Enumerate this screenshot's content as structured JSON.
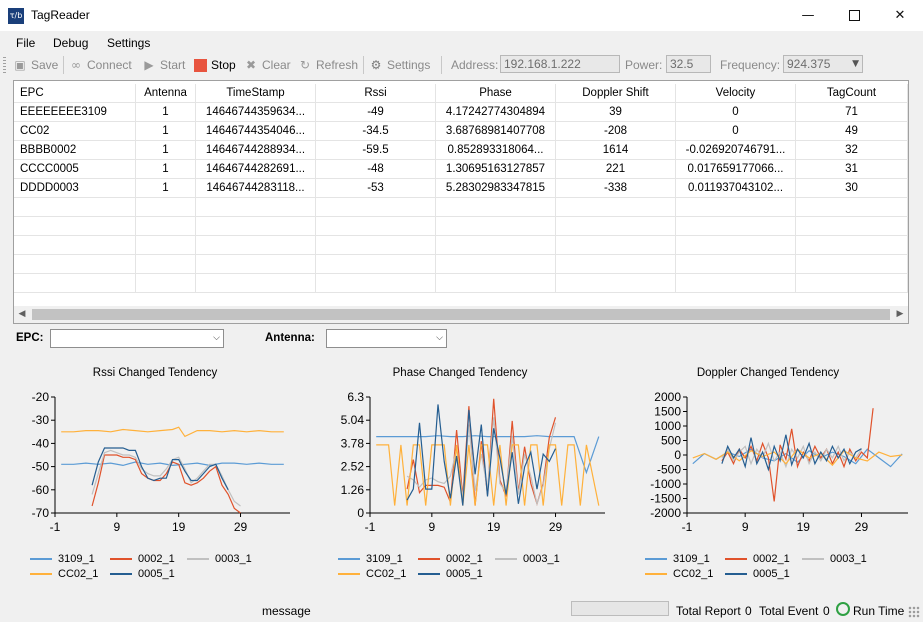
{
  "window": {
    "title": "TagReader",
    "icon_text": "τ/b"
  },
  "menu": [
    "File",
    "Debug",
    "Settings"
  ],
  "toolbar": {
    "save": "Save",
    "connect": "Connect",
    "start": "Start",
    "stop": "Stop",
    "clear": "Clear",
    "refresh": "Refresh",
    "settings": "Settings",
    "address_label": "Address:",
    "address_value": "192.168.1.222",
    "power_label": "Power:",
    "power_value": "32.5",
    "frequency_label": "Frequency:",
    "frequency_value": "924.375"
  },
  "table": {
    "columns": [
      "EPC",
      "Antenna",
      "TimeStamp",
      "Rssi",
      "Phase",
      "Doppler Shift",
      "Velocity",
      "TagCount"
    ],
    "rows": [
      [
        "EEEEEEEE3109",
        "1",
        "14646744359634...",
        "-49",
        "4.17242774304894",
        "39",
        "0",
        "71"
      ],
      [
        "CC02",
        "1",
        "14646744354046...",
        "-34.5",
        "3.68768981407708",
        "-208",
        "0",
        "49"
      ],
      [
        "BBBB0002",
        "1",
        "14646744288934...",
        "-59.5",
        "0.852893318064...",
        "1614",
        "-0.026920746791...",
        "32"
      ],
      [
        "CCCC0005",
        "1",
        "14646744282691...",
        "-48",
        "1.30695163127857",
        "221",
        "0.017659177066...",
        "31"
      ],
      [
        "DDDD0003",
        "1",
        "14646744283118...",
        "-53",
        "5.28302983347815",
        "-338",
        "0.011937043102...",
        "30"
      ]
    ]
  },
  "filters": {
    "epc_label": "EPC:",
    "antenna_label": "Antenna:",
    "epc_value": "",
    "antenna_value": ""
  },
  "colors": {
    "s3109": "#5b9bd5",
    "s0002": "#e0522b",
    "s0003": "#c0c0c0",
    "sCC02": "#ffb13b",
    "s0005": "#255e91"
  },
  "chart_data": [
    {
      "type": "line",
      "title": "Rssi Changed Tendency",
      "xlim": [
        -1,
        37
      ],
      "xticks": [
        -1,
        9,
        19,
        29
      ],
      "ylim": [
        -70,
        -20
      ],
      "yticks": [
        -20,
        -30,
        -40,
        -50,
        -60,
        -70
      ],
      "series": [
        {
          "name": "3109_1",
          "color": "#5b9bd5",
          "x": [
            0,
            2,
            4,
            6,
            8,
            10,
            12,
            14,
            16,
            18,
            20,
            22,
            24,
            26,
            28,
            30,
            32,
            34,
            36
          ],
          "y": [
            -49,
            -49,
            -48.5,
            -49,
            -48.5,
            -49.5,
            -48,
            -49,
            -48.5,
            -49.5,
            -49,
            -48.5,
            -49.5,
            -48.5,
            -48.5,
            -49,
            -48.5,
            -49,
            -49
          ]
        },
        {
          "name": "0002_1",
          "color": "#e0522b",
          "x": [
            5,
            6,
            7,
            8,
            9,
            10,
            11,
            12,
            13,
            14,
            15,
            16,
            17,
            18,
            19,
            20,
            21,
            22,
            23,
            24,
            25,
            26,
            27,
            28,
            29
          ],
          "y": [
            -67,
            -57,
            -45,
            -45,
            -45,
            -46,
            -46,
            -47,
            -53,
            -55,
            -56,
            -56,
            -53,
            -48,
            -49,
            -57,
            -58,
            -57,
            -55,
            -52,
            -50,
            -58,
            -62,
            -68,
            -70
          ]
        },
        {
          "name": "0003_1",
          "color": "#c0c0c0",
          "x": [
            5,
            6,
            7,
            8,
            9,
            10,
            11,
            12,
            13,
            14,
            15,
            16,
            17,
            18,
            19,
            20,
            21,
            22,
            23,
            24,
            25,
            26,
            27,
            28,
            29
          ],
          "y": [
            -62,
            -53,
            -44,
            -43,
            -44,
            -45,
            -45,
            -46,
            -51,
            -53,
            -54,
            -54,
            -51,
            -47,
            -46,
            -51,
            -57,
            -55,
            -52,
            -49,
            -49,
            -54,
            -60,
            -65,
            -67
          ]
        },
        {
          "name": "CC02_1",
          "color": "#ffb13b",
          "x": [
            0,
            2,
            4,
            6,
            8,
            10,
            12,
            14,
            16,
            18,
            19,
            20,
            22,
            24,
            26,
            28,
            30,
            32,
            34,
            36
          ],
          "y": [
            -35,
            -35,
            -34.5,
            -34.5,
            -35,
            -34,
            -34.5,
            -35,
            -34.5,
            -34,
            -33,
            -37,
            -34.5,
            -34.5,
            -35,
            -34.5,
            -35,
            -34.5,
            -35,
            -35
          ]
        },
        {
          "name": "0005_1",
          "color": "#255e91",
          "x": [
            5,
            6,
            7,
            8,
            9,
            10,
            11,
            12,
            13,
            14,
            15,
            16,
            17,
            18,
            19,
            20,
            21,
            22,
            23,
            24,
            25,
            26,
            27
          ],
          "y": [
            -58,
            -48,
            -42,
            -42,
            -42,
            -42,
            -43,
            -43,
            -50,
            -55,
            -56,
            -55,
            -55,
            -47,
            -47,
            -52,
            -56,
            -56,
            -53,
            -50,
            -49,
            -55,
            -60
          ]
        }
      ]
    },
    {
      "type": "line",
      "title": "Phase Changed Tendency",
      "xlim": [
        -1,
        37
      ],
      "xticks": [
        -1,
        9,
        19,
        29
      ],
      "ylim": [
        0,
        6.3
      ],
      "yticks": [
        6.3,
        5.04,
        3.78,
        2.52,
        1.26,
        0
      ],
      "series": [
        {
          "name": "3109_1",
          "color": "#5b9bd5",
          "x": [
            0,
            2,
            4,
            6,
            8,
            10,
            12,
            14,
            16,
            18,
            20,
            22,
            24,
            26,
            28,
            30,
            32,
            34,
            36
          ],
          "y": [
            4.15,
            4.15,
            4.15,
            4.15,
            4.15,
            4.2,
            4.15,
            4.15,
            4.2,
            4.15,
            4.15,
            4.15,
            4.15,
            4.2,
            4.15,
            4.15,
            4.15,
            2.2,
            4.15
          ]
        },
        {
          "name": "0002_1",
          "color": "#e0522b",
          "x": [
            5,
            6,
            7,
            8,
            9,
            10,
            11,
            12,
            13,
            14,
            15,
            16,
            17,
            18,
            19,
            20,
            21,
            22,
            23,
            24,
            25,
            26,
            27,
            28,
            29
          ],
          "y": [
            1.3,
            2.9,
            1.1,
            1.5,
            1.5,
            1.5,
            1.4,
            0.6,
            4.5,
            0.9,
            5.8,
            0.4,
            3.9,
            1.0,
            6.2,
            1.8,
            0.9,
            5.0,
            1.1,
            3.6,
            1.6,
            0.5,
            1.6,
            4.1,
            5.2
          ]
        },
        {
          "name": "0003_1",
          "color": "#c0c0c0",
          "x": [
            5,
            6,
            7,
            8,
            9,
            10,
            11,
            12,
            13,
            14,
            15,
            16,
            17,
            18,
            19,
            20,
            21,
            22,
            23,
            24,
            25,
            26,
            27,
            28,
            29
          ],
          "y": [
            2.0,
            1.8,
            1.4,
            1.8,
            1.9,
            1.7,
            1.6,
            2.0,
            3.5,
            0.8,
            4.8,
            1.2,
            3.2,
            1.3,
            5.2,
            1.6,
            1.1,
            4.2,
            1.0,
            3.2,
            2.0,
            0.5,
            1.5,
            3.5,
            4.9
          ]
        },
        {
          "name": "CC02_1",
          "color": "#ffb13b",
          "x": [
            0,
            2,
            3,
            4,
            5,
            6,
            7,
            8,
            9,
            10,
            11,
            12,
            13,
            14,
            15,
            16,
            17,
            18,
            19,
            20,
            21,
            22,
            23,
            24,
            25,
            26,
            27,
            28,
            29,
            30,
            31,
            32,
            33,
            34,
            36
          ],
          "y": [
            3.7,
            3.7,
            0.4,
            3.7,
            0.4,
            3.7,
            3.7,
            0.4,
            3.7,
            3.7,
            3.7,
            0.4,
            3.7,
            0.4,
            3.7,
            0.4,
            3.7,
            3.7,
            0.4,
            3.7,
            0.4,
            3.7,
            3.7,
            0.4,
            3.7,
            3.7,
            0.4,
            3.7,
            3.7,
            0.4,
            3.7,
            3.7,
            0.4,
            3.7,
            0.4
          ]
        },
        {
          "name": "0005_1",
          "color": "#255e91",
          "x": [
            5,
            6,
            7,
            8,
            9,
            10,
            11,
            12,
            13,
            14,
            15,
            16,
            17,
            18,
            19,
            20,
            21,
            22,
            23,
            24,
            25,
            26,
            27,
            28,
            29
          ],
          "y": [
            0.7,
            1.3,
            4.9,
            1.3,
            1.3,
            5.9,
            2.8,
            0.8,
            3.1,
            0.4,
            5.6,
            2.1,
            4.8,
            0.9,
            4.6,
            3.0,
            1.0,
            3.3,
            0.5,
            2.5,
            3.3,
            1.3,
            3.2,
            2.8,
            3.5
          ]
        }
      ]
    },
    {
      "type": "line",
      "title": "Doppler Changed Tendency",
      "xlim": [
        -1,
        37
      ],
      "xticks": [
        -1,
        9,
        19,
        29
      ],
      "ylim": [
        -2000,
        2000
      ],
      "yticks": [
        2000,
        1500,
        1000,
        500,
        0,
        -500,
        -1000,
        -1500,
        -2000
      ],
      "series": [
        {
          "name": "3109_1",
          "color": "#5b9bd5",
          "x": [
            0,
            2,
            4,
            6,
            8,
            10,
            12,
            14,
            16,
            18,
            20,
            22,
            24,
            26,
            28,
            30,
            32,
            34,
            36
          ],
          "y": [
            -300,
            50,
            -150,
            100,
            -50,
            200,
            -100,
            -200,
            50,
            -250,
            150,
            -100,
            100,
            -50,
            -300,
            200,
            -100,
            -400,
            39
          ]
        },
        {
          "name": "0002_1",
          "color": "#e0522b",
          "x": [
            5,
            6,
            7,
            8,
            9,
            10,
            11,
            12,
            13,
            14,
            15,
            16,
            17,
            18,
            19,
            20,
            21,
            22,
            23,
            24,
            25,
            26,
            27,
            28,
            29,
            30,
            31
          ],
          "y": [
            -200,
            100,
            -300,
            200,
            -100,
            300,
            -200,
            400,
            -100,
            -1600,
            350,
            -150,
            900,
            -400,
            100,
            -200,
            300,
            -100,
            200,
            -300,
            100,
            -400,
            200,
            -200,
            100,
            -100,
            1614
          ]
        },
        {
          "name": "0003_1",
          "color": "#c0c0c0",
          "x": [
            5,
            6,
            7,
            8,
            9,
            10,
            11,
            12,
            13,
            14,
            15,
            16,
            17,
            18,
            19,
            20,
            21,
            22,
            23,
            24,
            25,
            26,
            27,
            28,
            29
          ],
          "y": [
            -100,
            200,
            -200,
            100,
            300,
            -300,
            200,
            -100,
            400,
            -200,
            100,
            -400,
            200,
            -100,
            300,
            -300,
            100,
            -200,
            200,
            -100,
            300,
            -200,
            100,
            -100,
            200
          ]
        },
        {
          "name": "CC02_1",
          "color": "#ffb13b",
          "x": [
            0,
            2,
            4,
            6,
            8,
            10,
            12,
            14,
            16,
            18,
            20,
            22,
            24,
            26,
            28,
            30,
            32,
            34,
            36
          ],
          "y": [
            -100,
            50,
            -150,
            100,
            -200,
            150,
            -50,
            100,
            -300,
            200,
            -100,
            50,
            -350,
            150,
            -100,
            -208,
            100,
            -50,
            0
          ]
        },
        {
          "name": "0005_1",
          "color": "#255e91",
          "x": [
            5,
            6,
            7,
            8,
            9,
            10,
            11,
            12,
            13,
            14,
            15,
            16,
            17,
            18,
            19,
            20,
            21,
            22,
            23,
            24,
            25,
            26,
            27,
            28,
            29
          ],
          "y": [
            -300,
            300,
            -100,
            200,
            -400,
            600,
            -300,
            100,
            -500,
            300,
            -200,
            700,
            -338,
            200,
            -100,
            400,
            -300,
            100,
            -200,
            300,
            -100,
            200,
            -300,
            100,
            221
          ]
        }
      ]
    }
  ],
  "status": {
    "message": "message",
    "total_report_label": "Total Report",
    "total_report_value": "0",
    "total_event_label": "Total Event",
    "total_event_value": "0",
    "run_time_label": "Run Time"
  }
}
